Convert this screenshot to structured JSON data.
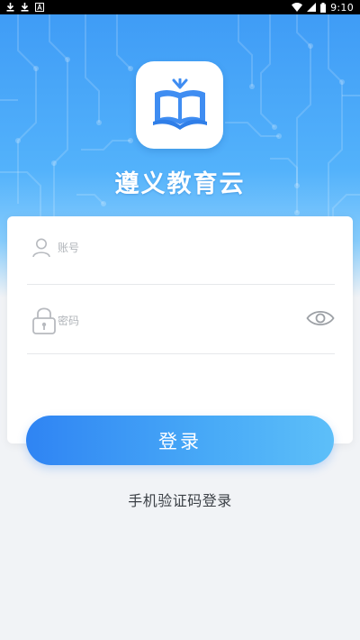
{
  "status_bar": {
    "time": "9:10",
    "icons": [
      "download-icon",
      "download-icon",
      "notification-a-icon",
      "wifi-icon",
      "signal-icon",
      "battery-icon"
    ]
  },
  "app": {
    "name": "遵义教育云",
    "logo_icon": "open-book-icon",
    "brand_color": "#3f9cf6"
  },
  "login_form": {
    "account": {
      "placeholder": "账号",
      "value": "",
      "icon": "person-icon"
    },
    "password": {
      "placeholder": "密码",
      "value": "",
      "icon": "lock-icon",
      "toggle_icon": "eye-icon"
    },
    "submit_label": "登录",
    "alt_login_label": "手机验证码登录"
  }
}
